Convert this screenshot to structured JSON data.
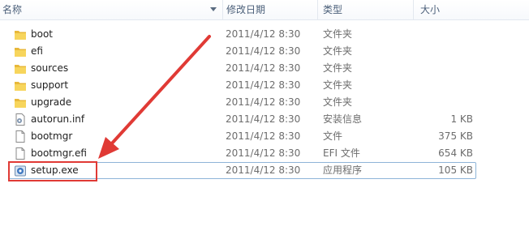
{
  "columns": {
    "name": "名称",
    "date": "修改日期",
    "type": "类型",
    "size": "大小"
  },
  "files": [
    {
      "name": "boot",
      "date": "2011/4/12 8:30",
      "type": "文件夹",
      "size": "",
      "icon": "folder-icon"
    },
    {
      "name": "efi",
      "date": "2011/4/12 8:30",
      "type": "文件夹",
      "size": "",
      "icon": "folder-icon"
    },
    {
      "name": "sources",
      "date": "2011/4/12 8:30",
      "type": "文件夹",
      "size": "",
      "icon": "folder-icon"
    },
    {
      "name": "support",
      "date": "2011/4/12 8:30",
      "type": "文件夹",
      "size": "",
      "icon": "folder-icon"
    },
    {
      "name": "upgrade",
      "date": "2011/4/12 8:30",
      "type": "文件夹",
      "size": "",
      "icon": "folder-icon"
    },
    {
      "name": "autorun.inf",
      "date": "2011/4/12 8:30",
      "type": "安装信息",
      "size": "1 KB",
      "icon": "settings-file-icon"
    },
    {
      "name": "bootmgr",
      "date": "2011/4/12 8:30",
      "type": "文件",
      "size": "375 KB",
      "icon": "file-icon"
    },
    {
      "name": "bootmgr.efi",
      "date": "2011/4/12 8:30",
      "type": "EFI 文件",
      "size": "654 KB",
      "icon": "file-icon"
    },
    {
      "name": "setup.exe",
      "date": "2011/4/12 8:30",
      "type": "应用程序",
      "size": "105 KB",
      "icon": "setup-exe-icon",
      "selected": true
    }
  ],
  "colors": {
    "annotation": "#e03a35",
    "folder": "#f5c842",
    "selection_border": "#8eb4d8"
  }
}
